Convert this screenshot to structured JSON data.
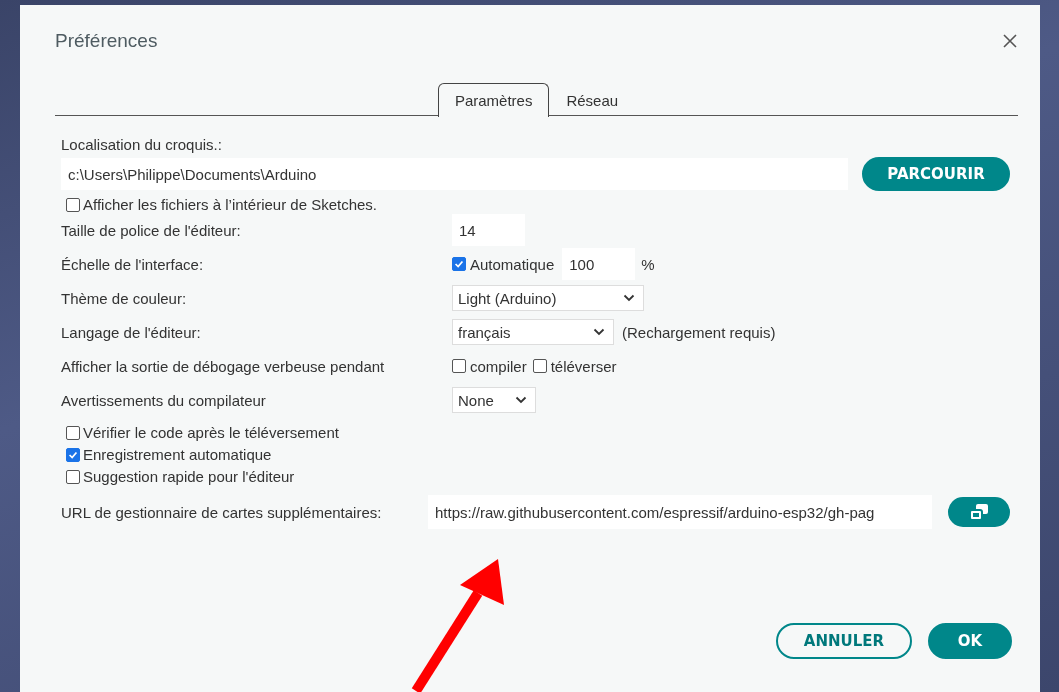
{
  "window": {
    "title": "Préférences"
  },
  "tabs": [
    {
      "label": "Paramètres",
      "selected": true
    },
    {
      "label": "Réseau",
      "selected": false
    }
  ],
  "sketchbook": {
    "label": "Localisation du croquis.:",
    "value": "c:\\Users\\Philippe\\Documents\\Arduino",
    "button": "PARCOURIR"
  },
  "show_files": {
    "label": "Afficher les fichiers à l’intérieur de Sketches.",
    "checked": false
  },
  "rows": [
    {
      "kind": "text",
      "label": "Taille de police de l'éditeur:",
      "value": "14"
    },
    {
      "kind": "scale",
      "label": "Échelle de l'interface:",
      "checkbox_label": "Automatique",
      "checked": true,
      "value": "100",
      "unit": "%"
    },
    {
      "kind": "select",
      "label": "Thème de couleur:",
      "value": "Light (Arduino)"
    },
    {
      "kind": "select",
      "label": "Langage de l'éditeur:",
      "value": "français",
      "note": "(Rechargement requis)"
    },
    {
      "kind": "checks",
      "label": "Afficher la sortie de débogage verbeuse pendant",
      "options": [
        {
          "label": "compiler",
          "checked": false
        },
        {
          "label": "téléverser",
          "checked": false
        }
      ]
    },
    {
      "kind": "select",
      "label": "Avertissements du compilateur",
      "value": "None"
    }
  ],
  "options": [
    {
      "label": "Vérifier le code après le téléversement",
      "checked": false
    },
    {
      "label": "Enregistrement automatique",
      "checked": true
    },
    {
      "label": "Suggestion rapide pour l'éditeur",
      "checked": false
    }
  ],
  "board_urls": {
    "label": "URL de gestionnaire de cartes supplémentaires:",
    "value": "https://raw.githubusercontent.com/espressif/arduino-esp32/gh-pag"
  },
  "buttons": [
    {
      "label": "ANNULER",
      "kind": "secondary"
    },
    {
      "label": "OK",
      "kind": "primary"
    }
  ]
}
